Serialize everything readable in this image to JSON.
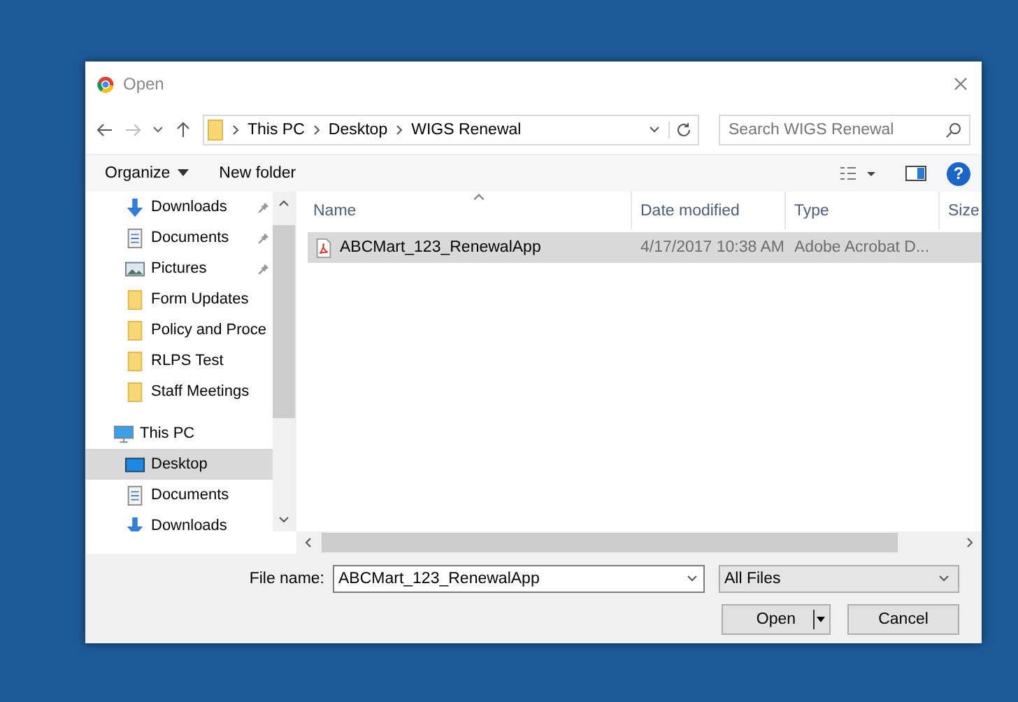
{
  "window": {
    "title": "Open"
  },
  "address": {
    "path": [
      "This PC",
      "Desktop",
      "WIGS Renewal"
    ]
  },
  "search": {
    "placeholder": "Search WIGS Renewal"
  },
  "toolbar": {
    "organize": "Organize",
    "new_folder": "New folder",
    "help": "?"
  },
  "nav": [
    {
      "label": "Downloads",
      "kind": "download",
      "pinned": true,
      "selected": false
    },
    {
      "label": "Documents",
      "kind": "document",
      "pinned": true,
      "selected": false
    },
    {
      "label": "Pictures",
      "kind": "pictures",
      "pinned": true,
      "selected": false
    },
    {
      "label": "Form Updates",
      "kind": "folder",
      "pinned": false,
      "selected": false
    },
    {
      "label": "Policy and Proce",
      "kind": "folder",
      "pinned": false,
      "selected": false
    },
    {
      "label": "RLPS Test",
      "kind": "folder",
      "pinned": false,
      "selected": false
    },
    {
      "label": "Staff Meetings",
      "kind": "folder",
      "pinned": false,
      "selected": false
    },
    {
      "label": "This PC",
      "kind": "pc",
      "pinned": false,
      "selected": false,
      "children": [
        {
          "label": "Desktop",
          "kind": "desktop",
          "pinned": false,
          "selected": true
        },
        {
          "label": "Documents",
          "kind": "document",
          "pinned": false,
          "selected": false
        },
        {
          "label": "Downloads",
          "kind": "download",
          "pinned": false,
          "selected": false
        }
      ]
    }
  ],
  "table": {
    "columns": [
      "Name",
      "Date modified",
      "Type",
      "Size"
    ],
    "rows": [
      {
        "name": "ABCMart_123_RenewalApp",
        "date": "4/17/2017 10:38 AM",
        "type": "Adobe Acrobat D...",
        "selected": true
      }
    ]
  },
  "file_name": {
    "label": "File name:",
    "value": "ABCMart_123_RenewalApp"
  },
  "file_type": {
    "value": "All Files"
  },
  "buttons": {
    "open": "Open",
    "cancel": "Cancel"
  }
}
